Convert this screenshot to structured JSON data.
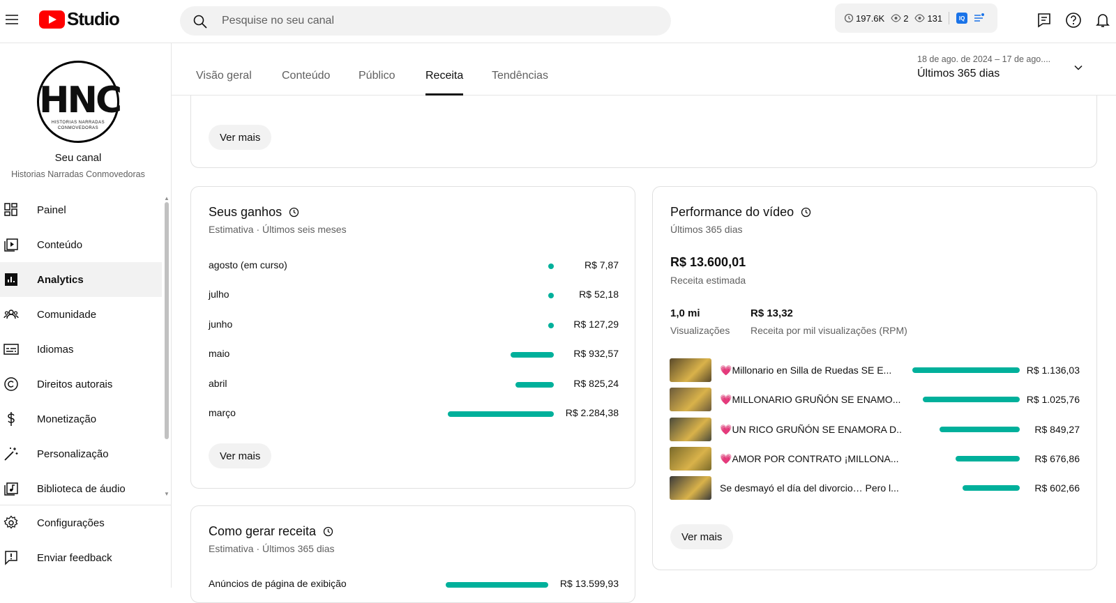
{
  "header": {
    "logo_text": "Studio",
    "search_placeholder": "Pesquise no seu canal",
    "stats": {
      "watch_hours": "197.6K",
      "live_viewers": "2",
      "views": "131"
    },
    "badge_label": "IQ"
  },
  "sidebar": {
    "avatar_initials": "HNC",
    "avatar_subtitle": "HISTORIAS NARRADAS CONMOVEDORAS",
    "title": "Seu canal",
    "channel_name": "Historias Narradas Conmovedoras",
    "items": [
      {
        "label": "Painel",
        "icon": "dashboard-icon"
      },
      {
        "label": "Conteúdo",
        "icon": "content-icon"
      },
      {
        "label": "Analytics",
        "icon": "analytics-icon",
        "active": true
      },
      {
        "label": "Comunidade",
        "icon": "community-icon"
      },
      {
        "label": "Idiomas",
        "icon": "subtitles-icon"
      },
      {
        "label": "Direitos autorais",
        "icon": "copyright-icon"
      },
      {
        "label": "Monetização",
        "icon": "dollar-icon"
      },
      {
        "label": "Personalização",
        "icon": "magic-wand-icon"
      },
      {
        "label": "Biblioteca de áudio",
        "icon": "audio-library-icon"
      }
    ],
    "bottom_items": [
      {
        "label": "Configurações",
        "icon": "gear-icon"
      },
      {
        "label": "Enviar feedback",
        "icon": "feedback-icon"
      }
    ]
  },
  "tabs": [
    "Visão geral",
    "Conteúdo",
    "Público",
    "Receita",
    "Tendências"
  ],
  "active_tab": "Receita",
  "date_range": {
    "dates": "18 de ago. de 2024 – 17 de ago....",
    "label": "Últimos 365 dias"
  },
  "top_card": {
    "button": "Ver mais"
  },
  "earnings": {
    "title": "Seus ganhos",
    "subtitle": "Estimativa · Últimos seis meses",
    "button": "Ver mais",
    "rows": [
      {
        "month": "agosto (em curso)",
        "value": "R$ 7,87",
        "amount": 7.87
      },
      {
        "month": "julho",
        "value": "R$ 52,18",
        "amount": 52.18
      },
      {
        "month": "junho",
        "value": "R$ 127,29",
        "amount": 127.29
      },
      {
        "month": "maio",
        "value": "R$ 932,57",
        "amount": 932.57
      },
      {
        "month": "abril",
        "value": "R$ 825,24",
        "amount": 825.24
      },
      {
        "month": "março",
        "value": "R$ 2.284,38",
        "amount": 2284.38
      }
    ]
  },
  "revenue_sources": {
    "title": "Como gerar receita",
    "subtitle": "Estimativa · Últimos 365 dias",
    "rows": [
      {
        "label": "Anúncios de página de exibição",
        "value": "R$ 13.599,93",
        "amount": 13599.93
      }
    ]
  },
  "video_performance": {
    "title": "Performance do vídeo",
    "subtitle": "Últimos 365 dias",
    "revenue_value": "R$ 13.600,01",
    "revenue_label": "Receita estimada",
    "views_value": "1,0 mi",
    "views_label": "Visualizações",
    "rpm_value": "R$ 13,32",
    "rpm_label": "Receita por mil visualizações (RPM)",
    "button": "Ver mais",
    "videos": [
      {
        "heart": "💗",
        "title": "Millonario en Silla de Ruedas SE E...",
        "value": "R$ 1.136,03",
        "amount": 1136.03,
        "thumb_color": "#5a4a2a"
      },
      {
        "heart": "💗",
        "title": "MILLONARIO GRUÑÓN SE ENAMO...",
        "value": "R$ 1.025,76",
        "amount": 1025.76,
        "thumb_color": "#6b5a3a"
      },
      {
        "heart": "💗",
        "title": "UN RICO GRUÑÓN SE ENAMORA D...",
        "value": "R$ 849,27",
        "amount": 849.27,
        "thumb_color": "#4a4a3a"
      },
      {
        "heart": "💗",
        "title": "AMOR POR CONTRATO ¡MILLONA...",
        "value": "R$ 676,86",
        "amount": 676.86,
        "thumb_color": "#7a6a2a"
      },
      {
        "heart": "",
        "title": "Se desmayó el día del divorcio… Pero l...",
        "value": "R$ 602,66",
        "amount": 602.66,
        "thumb_color": "#3a3a3a"
      }
    ]
  },
  "colors": {
    "accent_bar": "#00b09b",
    "brand_red": "#ff0000"
  }
}
